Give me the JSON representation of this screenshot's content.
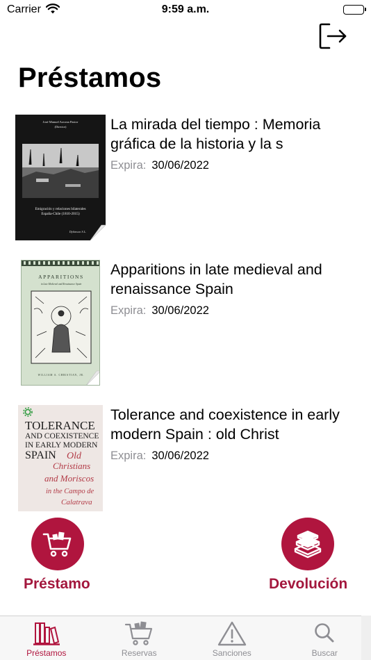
{
  "status_bar": {
    "carrier": "Carrier",
    "time": "9:59 a.m."
  },
  "header": {
    "title": "Préstamos",
    "logout_icon": "logout-icon"
  },
  "loans": [
    {
      "title": "La mirada del tiempo : Memoria gráfica de la historia y la s",
      "expire_label": "Expira:",
      "expire_date": "30/06/2022",
      "cover": {
        "author_line": "José Manuel Azcona Pastor",
        "editor_line": "(Director)",
        "subtitle": "Emigración y relaciones bilaterales",
        "subtitle2": "España-Chile (1810-2015)",
        "publisher": "Dykinson S.L."
      }
    },
    {
      "title": "Apparitions in late medieval and renaissance Spain",
      "expire_label": "Expira:",
      "expire_date": "30/06/2022",
      "cover": {
        "heading": "APPARITIONS",
        "subheading": "in Late Medieval and Renaissance Spain",
        "author": "WILLIAM A. CHRISTIAN, JR."
      }
    },
    {
      "title": "Tolerance and coexistence in early modern Spain : old Christ",
      "expire_label": "Expira:",
      "expire_date": "30/06/2022",
      "cover": {
        "line1": "TOLERANCE",
        "line2": "AND COEXISTENCE",
        "line3": "IN EARLY MODERN",
        "line4": "SPAIN",
        "script1": "Old",
        "script2": "Christians",
        "script3": "and Moriscos",
        "script4": "in the Campo de",
        "script5": "Calatrava"
      }
    }
  ],
  "actions": {
    "loan": {
      "label": "Préstamo",
      "icon": "cart-icon"
    },
    "return": {
      "label": "Devolución",
      "icon": "books-stack-icon"
    }
  },
  "tabs": [
    {
      "label": "Préstamos",
      "icon": "bookshelf-icon",
      "active": true
    },
    {
      "label": "Reservas",
      "icon": "cart-icon",
      "active": false
    },
    {
      "label": "Sanciones",
      "icon": "warning-icon",
      "active": false
    },
    {
      "label": "Buscar",
      "icon": "search-icon",
      "active": false
    }
  ],
  "colors": {
    "accent": "#b0153e",
    "secondary_text": "#8e8e93",
    "tab_bar": "#f7f7f7"
  }
}
